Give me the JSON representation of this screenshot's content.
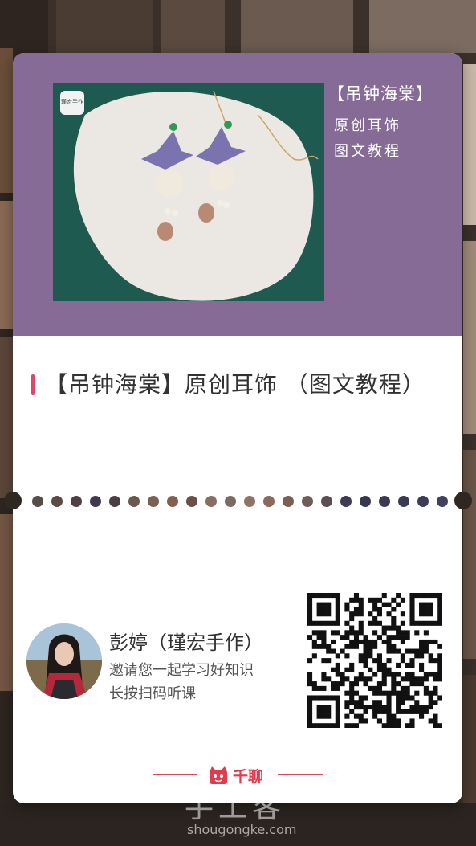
{
  "poster": {
    "side_title": "【吊钟海棠】",
    "side_lines": [
      "原创耳饰",
      "图文教程"
    ],
    "photo_logo": "瑾宏手作",
    "title": "【吊钟海棠】原创耳饰 （图文教程）"
  },
  "author": {
    "name": "彭婷（瑾宏手作）",
    "invite": "邀请您一起学习好知识",
    "scan_hint": "长按扫码听课"
  },
  "brand": {
    "name": "千聊",
    "accent": "#e23a4e"
  },
  "watermark": {
    "cn": "手工客",
    "en": "shougongke.com"
  },
  "colors": {
    "panel": "#876b97",
    "title_bar": "#e0456a"
  }
}
